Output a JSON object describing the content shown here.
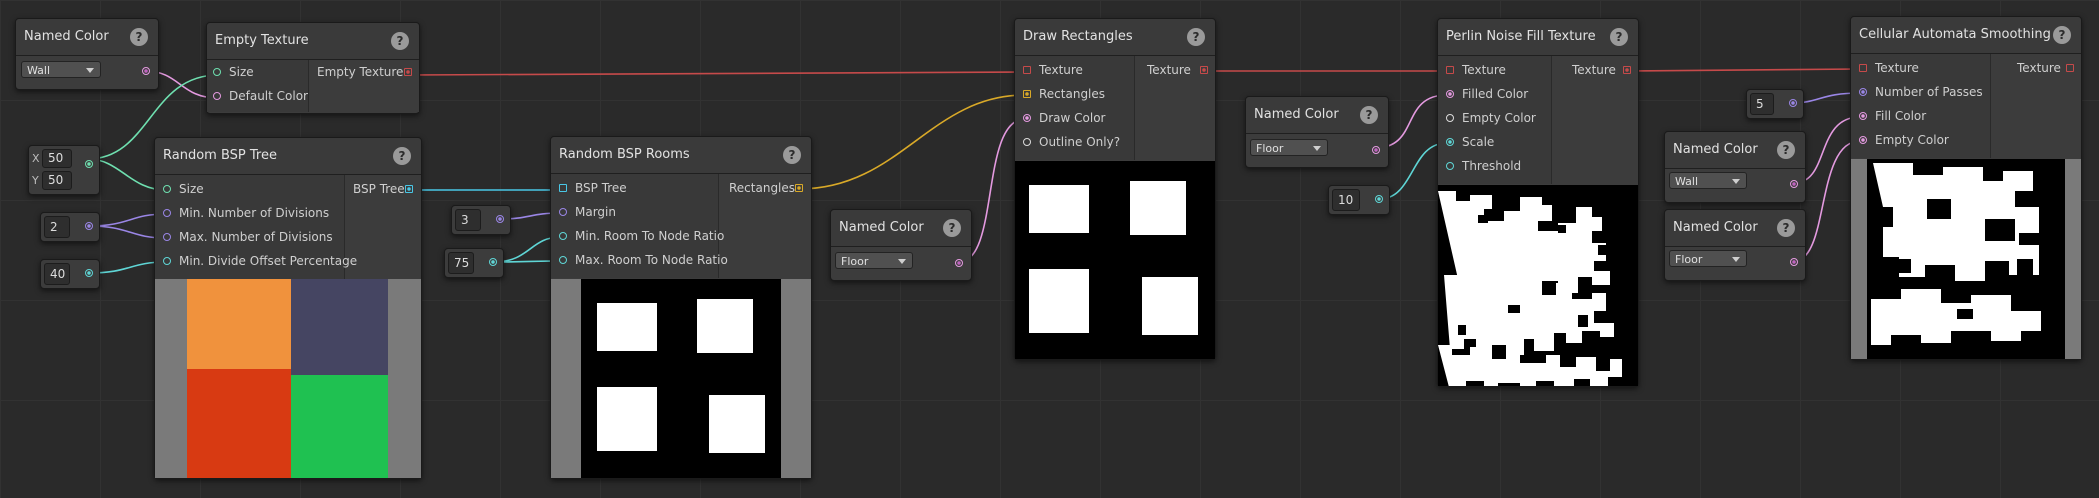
{
  "nodes": {
    "named_color_1": {
      "title": "Named Color",
      "value": "Wall"
    },
    "empty_texture": {
      "title": "Empty Texture",
      "inputs": [
        "Size",
        "Default Color"
      ],
      "output": "Empty Texture"
    },
    "size_input": {
      "x_label": "X",
      "y_label": "Y",
      "x": "50",
      "y": "50"
    },
    "min_div_value": "2",
    "min_offset_value": "40",
    "bsp_tree": {
      "title": "Random BSP Tree",
      "inputs": [
        "Size",
        "Min. Number of Divisions",
        "Max. Number of Divisions",
        "Min. Divide Offset Percentage"
      ],
      "output": "BSP Tree"
    },
    "margin_value": "3",
    "ratio_value": "75",
    "bsp_rooms": {
      "title": "Random BSP Rooms",
      "inputs": [
        "BSP Tree",
        "Margin",
        "Min. Room To Node Ratio",
        "Max. Room To Node Ratio"
      ],
      "output": "Rectangles"
    },
    "named_color_2": {
      "title": "Named Color",
      "value": "Floor"
    },
    "draw_rects": {
      "title": "Draw Rectangles",
      "inputs": [
        "Texture",
        "Rectangles",
        "Draw Color",
        "Outline Only?"
      ],
      "output": "Texture"
    },
    "named_color_3": {
      "title": "Named Color",
      "value": "Floor"
    },
    "scale_value": "10",
    "perlin": {
      "title": "Perlin Noise Fill Texture",
      "inputs": [
        "Texture",
        "Filled Color",
        "Empty Color",
        "Scale",
        "Threshold"
      ],
      "output": "Texture"
    },
    "passes_value": "5",
    "named_color_4": {
      "title": "Named Color",
      "value": "Wall"
    },
    "named_color_5": {
      "title": "Named Color",
      "value": "Floor"
    },
    "cellular": {
      "title": "Cellular Automata Smoothing",
      "inputs": [
        "Texture",
        "Number of Passes",
        "Fill Color",
        "Empty Color"
      ],
      "output": "Texture"
    }
  },
  "help_glyph": "?",
  "colors": {
    "texture_wire": "#c64a4a",
    "rect_wire": "#d9a928",
    "color_wire": "#e49ae0",
    "int_wire": "#9a86e6",
    "vec_wire": "#6fe0b0",
    "bsp_wire": "#49c7e6",
    "float_wire": "#5fd6d6",
    "bsp_orange": "#f0923d",
    "bsp_slate": "#454562",
    "bsp_red": "#d83a12",
    "bsp_green": "#1fc151"
  }
}
